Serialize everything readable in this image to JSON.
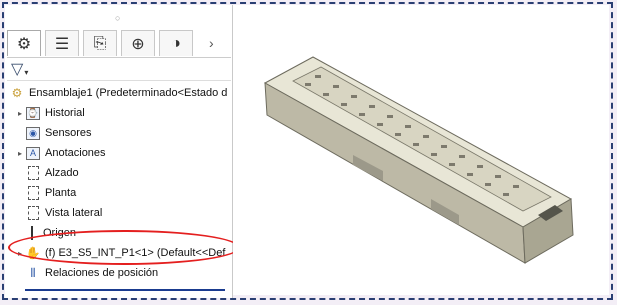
{
  "tabs": [
    {
      "name": "tab-feature-manager",
      "icon": "feature-manager-icon",
      "glyph": "⚙"
    },
    {
      "name": "tab-property-manager",
      "icon": "property-manager-icon",
      "glyph": "☰"
    },
    {
      "name": "tab-configuration-manager",
      "icon": "configuration-manager-icon",
      "glyph": "⎘"
    },
    {
      "name": "tab-dimxpert",
      "icon": "dimxpert-icon",
      "glyph": "⊕"
    },
    {
      "name": "tab-display-manager",
      "icon": "display-manager-icon",
      "glyph": "◑"
    }
  ],
  "tree": {
    "root": "Ensamblaje1  (Predeterminado<Estado d",
    "items": [
      {
        "label": "Historial",
        "icon": "history-icon",
        "glyph": "⌚",
        "expandable": true
      },
      {
        "label": "Sensores",
        "icon": "sensor-icon",
        "glyph": "◉",
        "expandable": false
      },
      {
        "label": "Anotaciones",
        "icon": "annotations-icon",
        "glyph": "A",
        "expandable": true
      },
      {
        "label": "Alzado",
        "icon": "plane-icon",
        "expandable": false
      },
      {
        "label": "Planta",
        "icon": "plane-icon",
        "expandable": false
      },
      {
        "label": "Vista lateral",
        "icon": "plane-icon",
        "expandable": false
      },
      {
        "label": "Origen",
        "icon": "origin-icon",
        "expandable": false
      },
      {
        "label": "(f) E3_S5_INT_P1<1> (Default<<Def",
        "icon": "part-icon",
        "glyph": "✋",
        "expandable": true
      },
      {
        "label": "Relaciones de posición",
        "icon": "mates-icon",
        "glyph": "⫴",
        "expandable": false
      }
    ]
  },
  "colors": {
    "frame": "#2a3f73",
    "highlight": "#e41f1f",
    "part_top": "#e8e6d6",
    "part_side": "#b9b6a3"
  }
}
